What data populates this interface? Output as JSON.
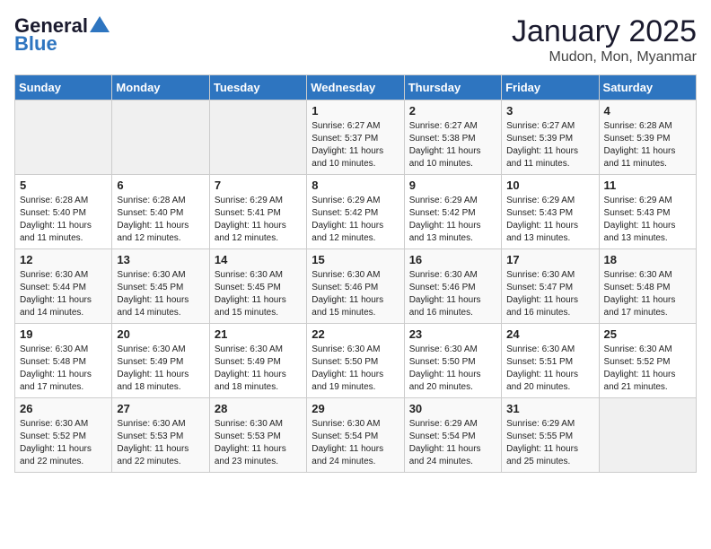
{
  "header": {
    "logo_main": "General",
    "logo_accent": "Blue",
    "title": "January 2025",
    "subtitle": "Mudon, Mon, Myanmar"
  },
  "weekdays": [
    "Sunday",
    "Monday",
    "Tuesday",
    "Wednesday",
    "Thursday",
    "Friday",
    "Saturday"
  ],
  "weeks": [
    [
      {
        "day": "",
        "info": ""
      },
      {
        "day": "",
        "info": ""
      },
      {
        "day": "",
        "info": ""
      },
      {
        "day": "1",
        "info": "Sunrise: 6:27 AM\nSunset: 5:37 PM\nDaylight: 11 hours and 10 minutes."
      },
      {
        "day": "2",
        "info": "Sunrise: 6:27 AM\nSunset: 5:38 PM\nDaylight: 11 hours and 10 minutes."
      },
      {
        "day": "3",
        "info": "Sunrise: 6:27 AM\nSunset: 5:39 PM\nDaylight: 11 hours and 11 minutes."
      },
      {
        "day": "4",
        "info": "Sunrise: 6:28 AM\nSunset: 5:39 PM\nDaylight: 11 hours and 11 minutes."
      }
    ],
    [
      {
        "day": "5",
        "info": "Sunrise: 6:28 AM\nSunset: 5:40 PM\nDaylight: 11 hours and 11 minutes."
      },
      {
        "day": "6",
        "info": "Sunrise: 6:28 AM\nSunset: 5:40 PM\nDaylight: 11 hours and 12 minutes."
      },
      {
        "day": "7",
        "info": "Sunrise: 6:29 AM\nSunset: 5:41 PM\nDaylight: 11 hours and 12 minutes."
      },
      {
        "day": "8",
        "info": "Sunrise: 6:29 AM\nSunset: 5:42 PM\nDaylight: 11 hours and 12 minutes."
      },
      {
        "day": "9",
        "info": "Sunrise: 6:29 AM\nSunset: 5:42 PM\nDaylight: 11 hours and 13 minutes."
      },
      {
        "day": "10",
        "info": "Sunrise: 6:29 AM\nSunset: 5:43 PM\nDaylight: 11 hours and 13 minutes."
      },
      {
        "day": "11",
        "info": "Sunrise: 6:29 AM\nSunset: 5:43 PM\nDaylight: 11 hours and 13 minutes."
      }
    ],
    [
      {
        "day": "12",
        "info": "Sunrise: 6:30 AM\nSunset: 5:44 PM\nDaylight: 11 hours and 14 minutes."
      },
      {
        "day": "13",
        "info": "Sunrise: 6:30 AM\nSunset: 5:45 PM\nDaylight: 11 hours and 14 minutes."
      },
      {
        "day": "14",
        "info": "Sunrise: 6:30 AM\nSunset: 5:45 PM\nDaylight: 11 hours and 15 minutes."
      },
      {
        "day": "15",
        "info": "Sunrise: 6:30 AM\nSunset: 5:46 PM\nDaylight: 11 hours and 15 minutes."
      },
      {
        "day": "16",
        "info": "Sunrise: 6:30 AM\nSunset: 5:46 PM\nDaylight: 11 hours and 16 minutes."
      },
      {
        "day": "17",
        "info": "Sunrise: 6:30 AM\nSunset: 5:47 PM\nDaylight: 11 hours and 16 minutes."
      },
      {
        "day": "18",
        "info": "Sunrise: 6:30 AM\nSunset: 5:48 PM\nDaylight: 11 hours and 17 minutes."
      }
    ],
    [
      {
        "day": "19",
        "info": "Sunrise: 6:30 AM\nSunset: 5:48 PM\nDaylight: 11 hours and 17 minutes."
      },
      {
        "day": "20",
        "info": "Sunrise: 6:30 AM\nSunset: 5:49 PM\nDaylight: 11 hours and 18 minutes."
      },
      {
        "day": "21",
        "info": "Sunrise: 6:30 AM\nSunset: 5:49 PM\nDaylight: 11 hours and 18 minutes."
      },
      {
        "day": "22",
        "info": "Sunrise: 6:30 AM\nSunset: 5:50 PM\nDaylight: 11 hours and 19 minutes."
      },
      {
        "day": "23",
        "info": "Sunrise: 6:30 AM\nSunset: 5:50 PM\nDaylight: 11 hours and 20 minutes."
      },
      {
        "day": "24",
        "info": "Sunrise: 6:30 AM\nSunset: 5:51 PM\nDaylight: 11 hours and 20 minutes."
      },
      {
        "day": "25",
        "info": "Sunrise: 6:30 AM\nSunset: 5:52 PM\nDaylight: 11 hours and 21 minutes."
      }
    ],
    [
      {
        "day": "26",
        "info": "Sunrise: 6:30 AM\nSunset: 5:52 PM\nDaylight: 11 hours and 22 minutes."
      },
      {
        "day": "27",
        "info": "Sunrise: 6:30 AM\nSunset: 5:53 PM\nDaylight: 11 hours and 22 minutes."
      },
      {
        "day": "28",
        "info": "Sunrise: 6:30 AM\nSunset: 5:53 PM\nDaylight: 11 hours and 23 minutes."
      },
      {
        "day": "29",
        "info": "Sunrise: 6:30 AM\nSunset: 5:54 PM\nDaylight: 11 hours and 24 minutes."
      },
      {
        "day": "30",
        "info": "Sunrise: 6:29 AM\nSunset: 5:54 PM\nDaylight: 11 hours and 24 minutes."
      },
      {
        "day": "31",
        "info": "Sunrise: 6:29 AM\nSunset: 5:55 PM\nDaylight: 11 hours and 25 minutes."
      },
      {
        "day": "",
        "info": ""
      }
    ]
  ]
}
